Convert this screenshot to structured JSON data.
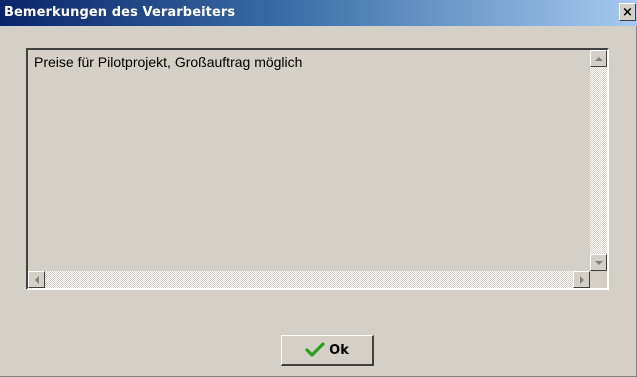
{
  "window": {
    "title": "Bemerkungen des Verarbeiters",
    "close_glyph": "×"
  },
  "memo": {
    "text": "Preise für Pilotprojekt, Großauftrag möglich"
  },
  "buttons": {
    "ok_label": "Ok",
    "ok_icon": "checkmark-icon"
  },
  "colors": {
    "titlebar_start": "#0a246a",
    "titlebar_end": "#a6caf0",
    "face": "#d4d0c8",
    "check_green": "#2e9e1f"
  }
}
